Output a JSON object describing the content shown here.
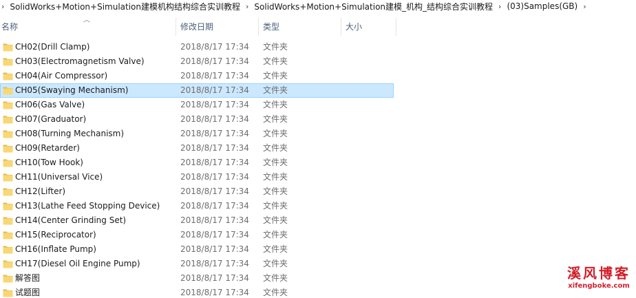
{
  "breadcrumb": {
    "items": [
      "SolidWorks+Motion+Simulation建模机构结构综合实训教程",
      "SolidWorks+Motion+Simulation建模_机构_结构综合实训教程",
      "(03)Samples(GB)"
    ],
    "separator_icon": "chevron-right-icon"
  },
  "columns": {
    "name": "名称",
    "date": "修改日期",
    "type": "类型",
    "size": "大小",
    "sort_icon": "sort-ascending-icon"
  },
  "files": [
    {
      "name": "CH02(Drill Clamp)",
      "date": "2018/8/17 17:34",
      "type": "文件夹",
      "icon": "folder-icon"
    },
    {
      "name": "CH03(Electromagnetism Valve)",
      "date": "2018/8/17 17:34",
      "type": "文件夹",
      "icon": "folder-icon"
    },
    {
      "name": "CH04(Air Compressor)",
      "date": "2018/8/17 17:34",
      "type": "文件夹",
      "icon": "folder-icon"
    },
    {
      "name": "CH05(Swaying Mechanism)",
      "date": "2018/8/17 17:34",
      "type": "文件夹",
      "icon": "folder-icon",
      "selected": true
    },
    {
      "name": "CH06(Gas Valve)",
      "date": "2018/8/17 17:34",
      "type": "文件夹",
      "icon": "folder-icon"
    },
    {
      "name": "CH07(Graduator)",
      "date": "2018/8/17 17:34",
      "type": "文件夹",
      "icon": "folder-icon"
    },
    {
      "name": "CH08(Turning Mechanism)",
      "date": "2018/8/17 17:34",
      "type": "文件夹",
      "icon": "folder-icon"
    },
    {
      "name": "CH09(Retarder)",
      "date": "2018/8/17 17:34",
      "type": "文件夹",
      "icon": "folder-icon"
    },
    {
      "name": "CH10(Tow Hook)",
      "date": "2018/8/17 17:34",
      "type": "文件夹",
      "icon": "folder-icon"
    },
    {
      "name": "CH11(Universal Vice)",
      "date": "2018/8/17 17:34",
      "type": "文件夹",
      "icon": "folder-icon"
    },
    {
      "name": "CH12(Lifter)",
      "date": "2018/8/17 17:34",
      "type": "文件夹",
      "icon": "folder-icon"
    },
    {
      "name": "CH13(Lathe Feed Stopping Device)",
      "date": "2018/8/17 17:34",
      "type": "文件夹",
      "icon": "folder-icon"
    },
    {
      "name": "CH14(Center Grinding Set)",
      "date": "2018/8/17 17:34",
      "type": "文件夹",
      "icon": "folder-icon"
    },
    {
      "name": "CH15(Reciprocator)",
      "date": "2018/8/17 17:34",
      "type": "文件夹",
      "icon": "folder-icon"
    },
    {
      "name": "CH16(Inflate Pump)",
      "date": "2018/8/17 17:34",
      "type": "文件夹",
      "icon": "folder-icon"
    },
    {
      "name": "CH17(Diesel Oil Engine Pump)",
      "date": "2018/8/17 17:34",
      "type": "文件夹",
      "icon": "folder-icon"
    },
    {
      "name": "解答图",
      "date": "2018/8/17 17:34",
      "type": "文件夹",
      "icon": "folder-icon"
    },
    {
      "name": "试题图",
      "date": "2018/8/17 17:34",
      "type": "文件夹",
      "icon": "folder-icon"
    }
  ],
  "watermark": {
    "title": "溪风博客",
    "url": "xifengboke.com"
  },
  "colors": {
    "selection_bg": "#cce8ff",
    "selection_border": "#99d1ff",
    "folder": "#f8d775",
    "header_text": "#4c607a",
    "watermark": "#d21f2a"
  }
}
